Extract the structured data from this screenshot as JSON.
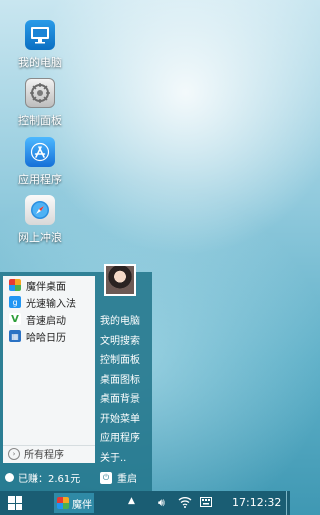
{
  "desktop": {
    "icons": [
      {
        "label": "我的电脑",
        "icon": "computer-icon"
      },
      {
        "label": "控制面板",
        "icon": "control-panel-icon"
      },
      {
        "label": "应用程序",
        "icon": "app-store-icon"
      },
      {
        "label": "网上冲浪",
        "icon": "browser-compass-icon"
      }
    ]
  },
  "start_menu": {
    "programs": [
      {
        "label": "魔伴桌面",
        "icon": "mobanzhuomian-icon",
        "color": "#f5a623"
      },
      {
        "label": "光速输入法",
        "icon": "input-method-icon",
        "color": "#2196f3"
      },
      {
        "label": "音速启动",
        "icon": "v-launcher-icon",
        "color": "#2e9e3a"
      },
      {
        "label": "哈哈日历",
        "icon": "calendar-icon",
        "color": "#2a72c4"
      }
    ],
    "all_programs": "所有程序",
    "right_items": [
      "我的电脑",
      "文明搜索",
      "控制面板",
      "桌面图标",
      "桌面背景",
      "开始菜单",
      "应用程序",
      "关于.."
    ],
    "balance": "已赚：2.61元",
    "restart": "重启"
  },
  "taskbar": {
    "app_label": "魔伴",
    "clock": "17:12:32"
  },
  "colors": {
    "menu_bg": "#23768c",
    "taskbar_bg": "#1a5d73"
  }
}
